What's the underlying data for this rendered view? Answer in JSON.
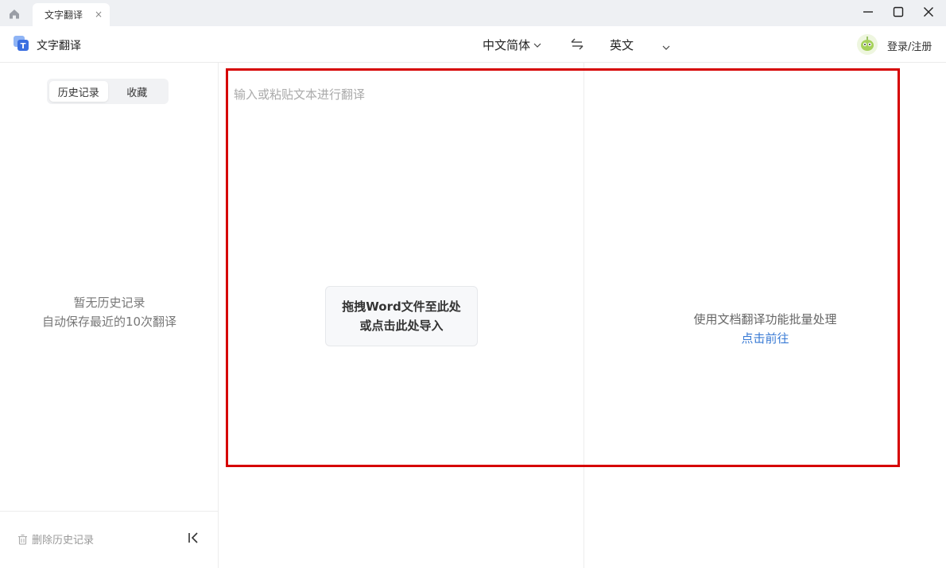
{
  "titlebar": {
    "tab_label": "文字翻译",
    "tab_close": "×"
  },
  "toolbar": {
    "app_title": "文字翻译",
    "source_language": "中文简体",
    "target_language": "英文",
    "login_label": "登录/注册"
  },
  "sidebar": {
    "tabs": [
      {
        "label": "历史记录",
        "active": true
      },
      {
        "label": "收藏",
        "active": false
      }
    ],
    "empty_title": "暂无历史记录",
    "empty_subtitle": "自动保存最近的10次翻译",
    "delete_label": "删除历史记录"
  },
  "editor": {
    "placeholder": "输入或粘贴文本进行翻译",
    "drop_line1": "拖拽Word文件至此处",
    "drop_line2": "或点击此处导入"
  },
  "result": {
    "doc_hint": "使用文档翻译功能批量处理",
    "doc_link": "点击前往"
  },
  "colors": {
    "accent": "#3a7bd5",
    "highlight_border": "#d60000"
  }
}
